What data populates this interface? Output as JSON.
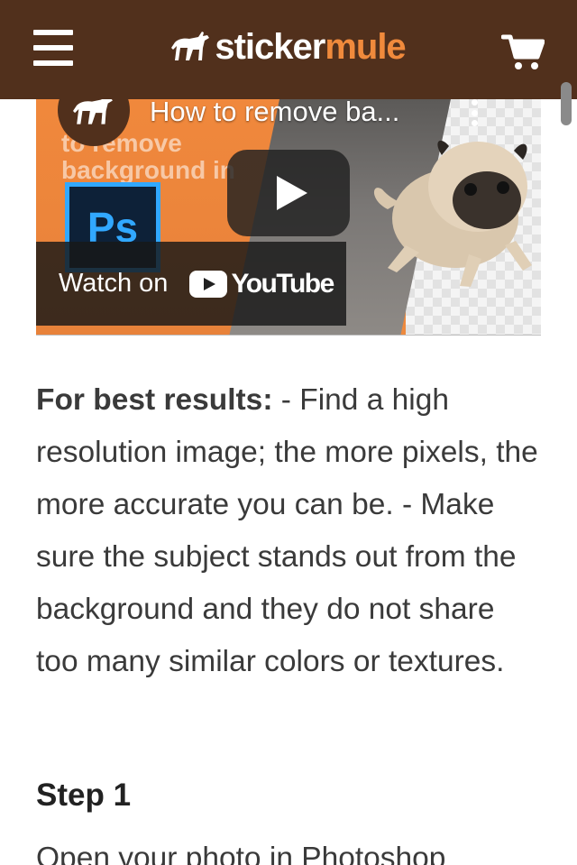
{
  "header": {
    "logo": {
      "part1": "sticker",
      "part2": "mule"
    },
    "colors": {
      "bar": "#51301c",
      "accent": "#f08a3c"
    },
    "menu_icon": "hamburger-menu-icon",
    "cart_icon": "shopping-cart-icon"
  },
  "video": {
    "title": "How to remove ba...",
    "thumbnail_text": "to remove\nbackground in",
    "ps_label": "Ps",
    "watch_label": "Watch on",
    "youtube_label": "YouTube"
  },
  "article": {
    "intro_bold": "For best results:",
    "intro_text": " - Find a high resolution image; the more pixels, the more accurate you can be. - Make sure the subject stands out from the background and they do not share too many similar colors or textures.",
    "step_heading": "Step 1",
    "step_text_partial": "Open your photo in Photoshop"
  }
}
